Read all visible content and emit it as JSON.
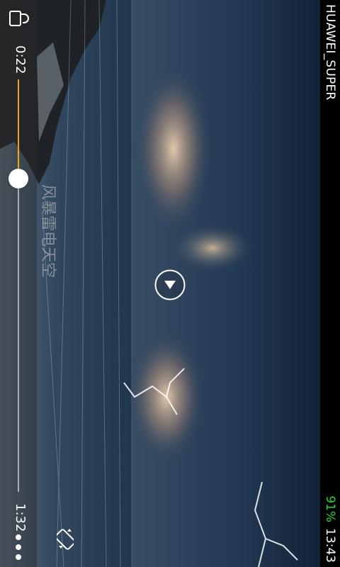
{
  "status_bar": {
    "carrier": "HUAWEI_SUPER",
    "battery": "91%",
    "clock": "13:43"
  },
  "player": {
    "title": "风暴雷电天空",
    "elapsed": "0:22",
    "total": "1:32",
    "progress": 0.24,
    "accent_color": "#f2a21b",
    "icons": [
      "lock-icon",
      "play-icon",
      "rotate-screen-icon",
      "more-icon"
    ]
  }
}
